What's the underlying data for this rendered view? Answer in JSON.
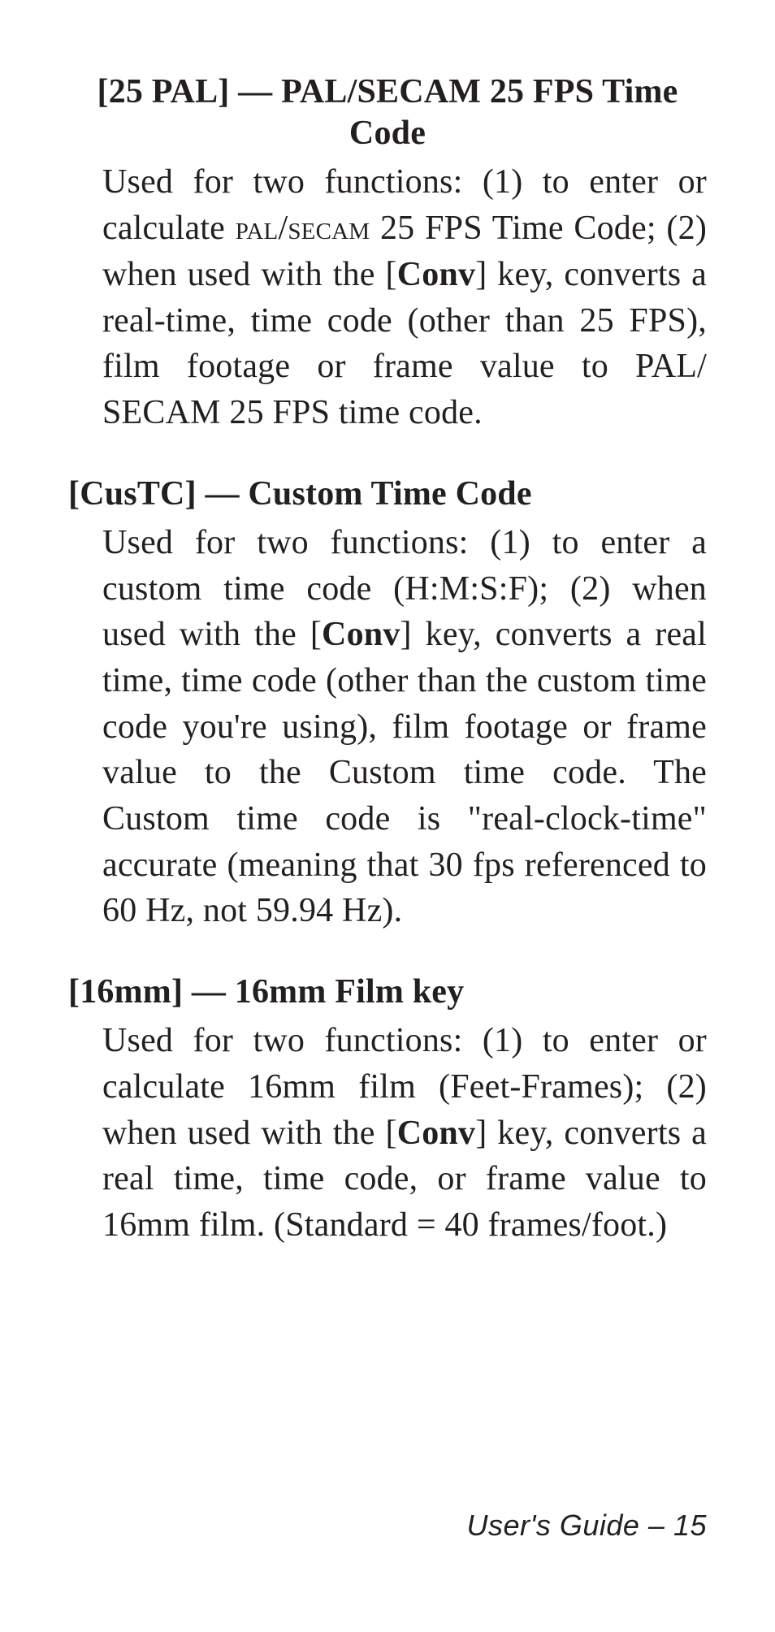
{
  "entries": [
    {
      "key_open": "[",
      "key_name": "25 PAL",
      "key_close": "]",
      "sep": " — ",
      "title": "PAL/SECAM 25 FPS Time Code",
      "body_pre": "Used for two functions: (1) to enter or calculate ",
      "body_sc1": "Pal",
      "body_mid1": "/",
      "body_sc2": "Secam",
      "body_mid2": " 25 FPS Time Code; (2) when used with the [",
      "conv": "Conv",
      "body_post": "] key, converts a real-time, time code (other than 25 FPS), film footage or frame value to PAL/ SECAM 25 FPS time code."
    },
    {
      "key_open": "[",
      "key_name": "CusTC",
      "key_close": "]",
      "sep": " — ",
      "title": "Custom Time Code",
      "body_pre": "Used for two functions: (1) to enter a custom time code (H:M:S:F); (2) when used with the [",
      "conv": "Conv",
      "body_post": "] key, converts a real time, time code (other than the custom time code you're using), film footage or frame value to the Custom time code. The Custom time code is \"real-clock-time\" accurate (meaning that 30 fps referenced to 60 Hz, not 59.94 Hz)."
    },
    {
      "key_open": "[",
      "key_name": "16mm",
      "key_close": "]",
      "sep": " — ",
      "title": "16mm Film key",
      "body_pre": "Used for two functions: (1) to enter or calculate 16mm film (Feet-Frames); (2) when used with the [",
      "conv": "Conv",
      "body_post": "] key, converts a real time, time code, or frame value to 16mm film. (Standard = 40 frames/foot.)"
    }
  ],
  "footer": {
    "label": "User's Guide – ",
    "page": "15"
  }
}
